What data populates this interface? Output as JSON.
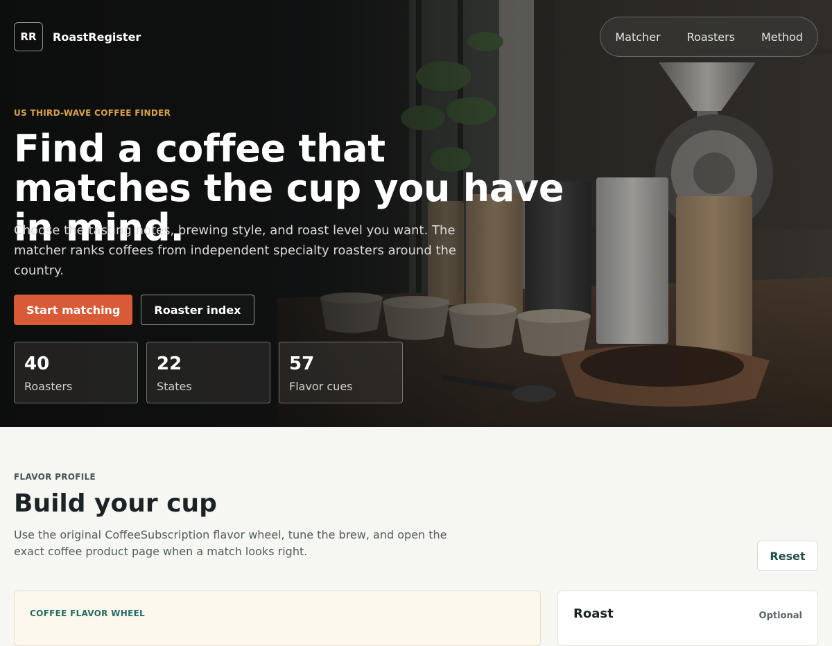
{
  "brand": {
    "mark": "RR",
    "name": "RoastRegister"
  },
  "nav": {
    "items": [
      "Matcher",
      "Roasters",
      "Method"
    ]
  },
  "hero": {
    "eyebrow": "US THIRD-WAVE COFFEE FINDER",
    "headline": "Find a coffee that matches the cup you have in mind.",
    "lead": "Choose the tasting notes, brewing style, and roast level you want. The matcher ranks coffees from independent specialty roasters around the country.",
    "primary_cta": "Start matching",
    "secondary_cta": "Roaster index",
    "stats": [
      {
        "value": "40",
        "label": "Roasters"
      },
      {
        "value": "22",
        "label": "States"
      },
      {
        "value": "57",
        "label": "Flavor cues"
      }
    ]
  },
  "flavor": {
    "eyebrow": "FLAVOR PROFILE",
    "title": "Build your cup",
    "description": "Use the original CoffeeSubscription flavor wheel, tune the brew, and open the exact coffee product page when a match looks right.",
    "reset_label": "Reset",
    "wheel_label": "COFFEE FLAVOR WHEEL",
    "roast_title": "Roast",
    "roast_optional": "Optional"
  },
  "colors": {
    "accent": "#d95a37",
    "eyebrow_gold": "#d9a24a",
    "teal": "#236b62",
    "background": "#f6f7f2"
  }
}
